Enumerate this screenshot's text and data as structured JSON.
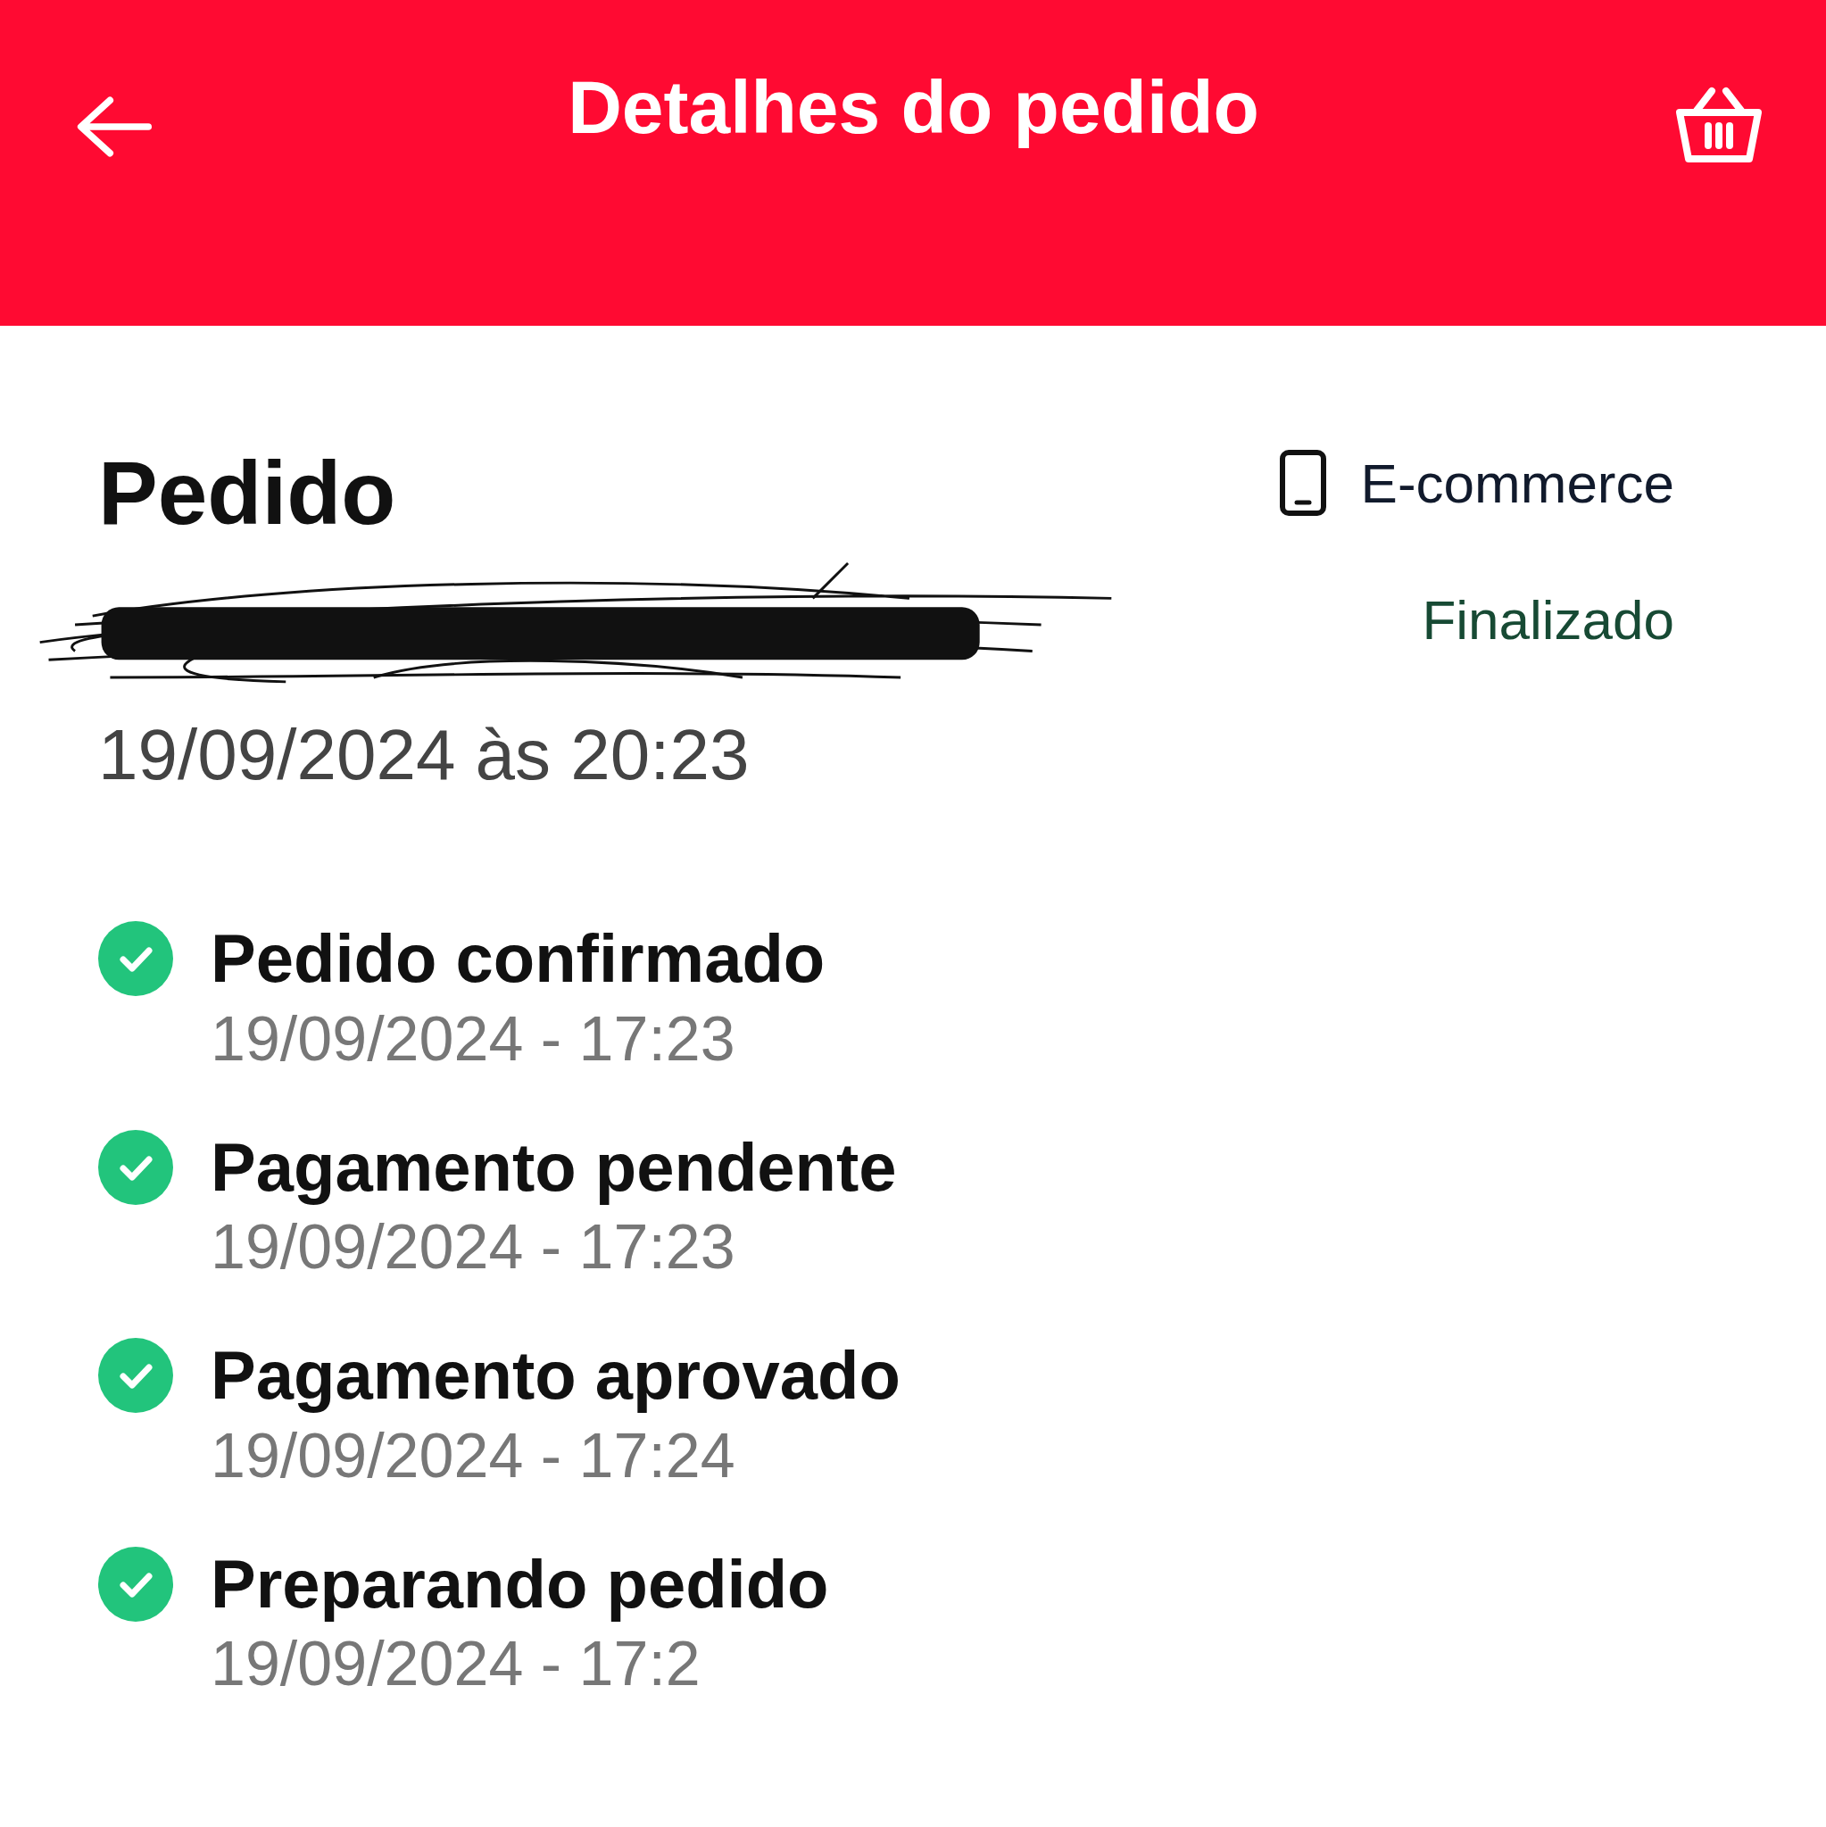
{
  "header": {
    "title": "Detalhes do pedido"
  },
  "order": {
    "heading": "Pedido",
    "date": "19/09/2024 às 20:23",
    "channel": "E-commerce",
    "status": "Finalizado"
  },
  "steps": [
    {
      "title": "Pedido confirmado",
      "time": "19/09/2024 - 17:23",
      "done": true
    },
    {
      "title": "Pagamento pendente",
      "time": "19/09/2024 - 17:23",
      "done": true
    },
    {
      "title": "Pagamento aprovado",
      "time": "19/09/2024 - 17:24",
      "done": true
    },
    {
      "title": "Preparando pedido",
      "time": "19/09/2024 - 17:2",
      "done": true
    }
  ]
}
